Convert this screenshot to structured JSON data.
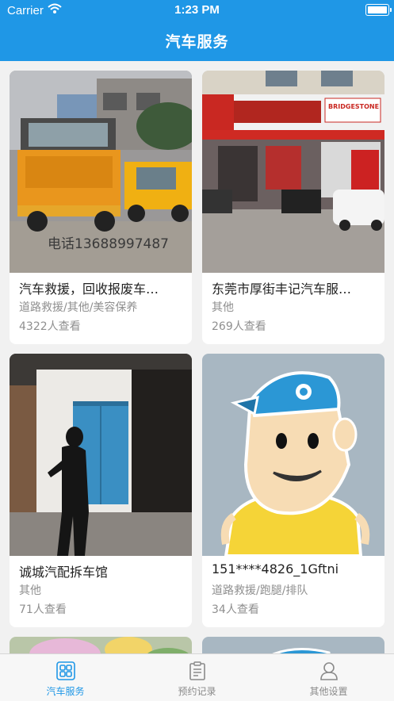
{
  "status_bar": {
    "carrier": "Carrier",
    "time": "1:23 PM"
  },
  "header": {
    "title": "汽车服务"
  },
  "cards": [
    {
      "name": "汽车救援，回收报废车…",
      "categories": "道路救援/其他/美容保养",
      "views": "4322人查看",
      "image_text": "电话13688997487"
    },
    {
      "name": "东莞市厚街丰记汽车服…",
      "categories": "其他",
      "views": "269人查看",
      "image_text": "BRIDGESTONE"
    },
    {
      "name": "诚城汽配拆车馆",
      "categories": "其他",
      "views": "71人查看"
    },
    {
      "name": "151****4826_1Gftni",
      "categories": "道路救援/跑腿/排队",
      "views": "34人查看"
    }
  ],
  "tabbar": {
    "tabs": [
      {
        "label": "汽车服务",
        "icon": "grid-icon",
        "active": true
      },
      {
        "label": "预约记录",
        "icon": "clipboard-icon",
        "active": false
      },
      {
        "label": "其他设置",
        "icon": "person-icon",
        "active": false
      }
    ]
  },
  "colors": {
    "accent": "#1f97e6",
    "background": "#f1f1f1",
    "muted_text": "#8f8f8f"
  }
}
